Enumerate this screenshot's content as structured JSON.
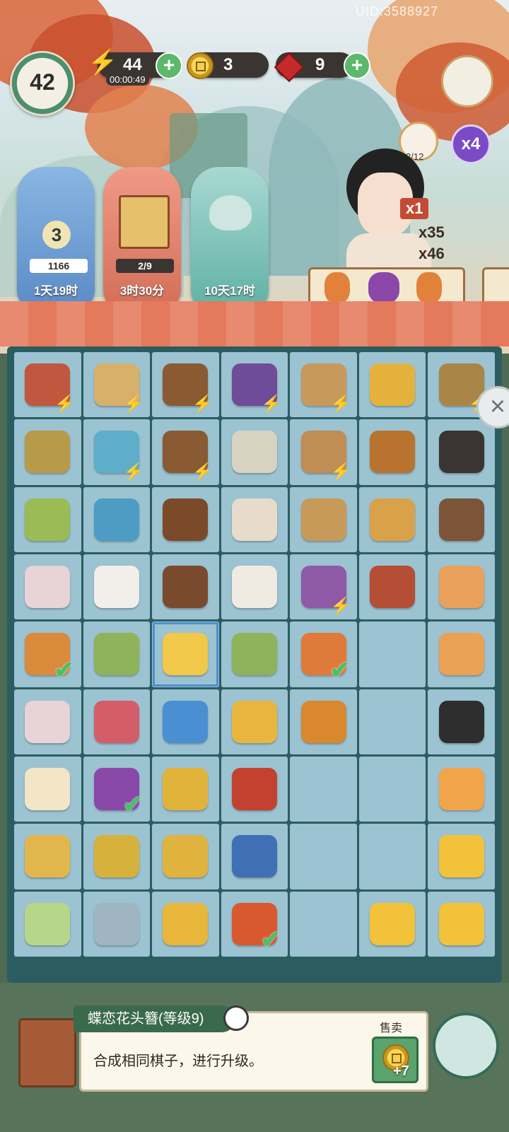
{
  "header": {
    "uid": "UID:3588927",
    "level": "42",
    "energy": "44",
    "energy_timer": "00:00:49",
    "coins": "3",
    "gems": "9"
  },
  "cat_progress": "3/12",
  "multiplier": "x4",
  "events": [
    {
      "name": "lotus",
      "number": "3",
      "value": "1166",
      "time": "1天19时"
    },
    {
      "name": "scroll",
      "value": "2/9",
      "time": "3时30分"
    },
    {
      "name": "spa-cat",
      "time": "10天17时"
    }
  ],
  "order": {
    "rewards": [
      "x1",
      "x35",
      "x46"
    ]
  },
  "board": {
    "rows": [
      [
        {
          "c": "#c0573e",
          "b": 1
        },
        {
          "c": "#d9b06a",
          "b": 1
        },
        {
          "c": "#8a5a33",
          "b": 1
        },
        {
          "c": "#6f4b9a",
          "b": 1
        },
        {
          "c": "#c79a5c",
          "b": 1
        },
        {
          "c": "#e4b23c"
        },
        {
          "c": "#a98647",
          "b": 1
        }
      ],
      [
        {
          "c": "#b79b48"
        },
        {
          "c": "#5eaec9",
          "b": 1
        },
        {
          "c": "#8a5a33",
          "b": 1
        },
        {
          "c": "#d8d2c3"
        },
        {
          "c": "#c08d54",
          "b": 1
        },
        {
          "c": "#b8742f"
        },
        {
          "c": "#3a3432"
        }
      ],
      [
        {
          "c": "#9bbb55"
        },
        {
          "c": "#4c9cc4"
        },
        {
          "c": "#7b4a28"
        },
        {
          "c": "#e7dccb"
        },
        {
          "c": "#c89a5a"
        },
        {
          "c": "#d9a24a"
        },
        {
          "c": "#7c5438"
        }
      ],
      [
        {
          "c": "#e8d3d6"
        },
        {
          "c": "#f2eeea"
        },
        {
          "c": "#7a4a2e"
        },
        {
          "c": "#f0ebe2"
        },
        {
          "c": "#8e5aa8",
          "b": 1
        },
        {
          "c": "#b44e34"
        },
        {
          "c": "#e9a05a"
        }
      ],
      [
        {
          "c": "#d98a3a",
          "k": 1
        },
        {
          "c": "#8fb35a"
        },
        {
          "c": "#f1c84a",
          "s": 1
        },
        {
          "c": "#8fb35a"
        },
        {
          "c": "#e07a3a",
          "k": 1
        },
        {
          "c": ""
        },
        {
          "c": "#eaa154"
        }
      ],
      [
        {
          "c": "#e8d3d6"
        },
        {
          "c": "#d45d6a"
        },
        {
          "c": "#4a8fd1"
        },
        {
          "c": "#e8b63e"
        },
        {
          "c": "#d9882e"
        },
        {
          "c": ""
        },
        {
          "c": "#2e2e2e"
        }
      ],
      [
        {
          "c": "#f2e6c6"
        },
        {
          "c": "#8a48a8",
          "k": 1
        },
        {
          "c": "#e2b33a"
        },
        {
          "c": "#c3412f"
        },
        {
          "c": ""
        },
        {
          "c": ""
        },
        {
          "c": "#f1a54b"
        }
      ],
      [
        {
          "c": "#e1b64c"
        },
        {
          "c": "#d6b23c"
        },
        {
          "c": "#e0b33f"
        },
        {
          "c": "#3f6fb5"
        },
        {
          "c": ""
        },
        {
          "c": ""
        },
        {
          "c": "#f2c23a"
        }
      ],
      [
        {
          "c": "#b8d68a"
        },
        {
          "c": "#9fb6c2"
        },
        {
          "c": "#e7b63a"
        },
        {
          "c": "#d9592f",
          "k": 1
        },
        {
          "c": ""
        },
        {
          "c": "#f2c23a"
        },
        {
          "c": "#f2c23a"
        }
      ]
    ]
  },
  "info_panel": {
    "title": "蝶恋花头簪(等级9)",
    "description": "合成相同棋子，进行升级。",
    "sell_label": "售卖",
    "sell_value": "+7"
  }
}
